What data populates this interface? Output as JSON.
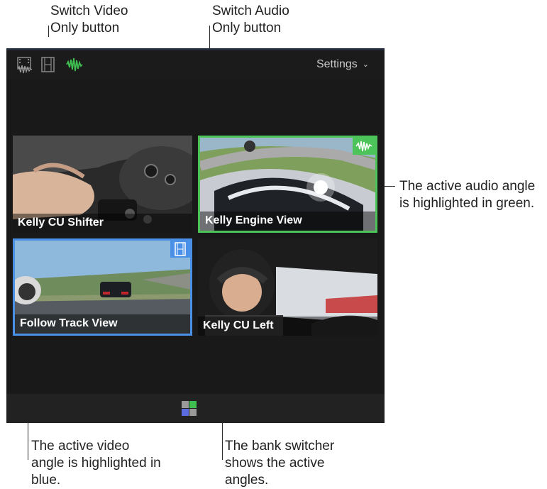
{
  "callouts": {
    "video_only": [
      "Switch Video",
      "Only button"
    ],
    "audio_only": [
      "Switch Audio",
      "Only button"
    ],
    "audio_angle": [
      "The active audio angle",
      "is highlighted in green."
    ],
    "video_angle": [
      "The active video",
      "angle is highlighted in",
      "blue."
    ],
    "bank": [
      "The bank switcher",
      "shows the active",
      "angles."
    ]
  },
  "toolbar": {
    "settings_label": "Settings",
    "settings_chevron": "⌄",
    "buttons": [
      "switch-video-and-audio-icon",
      "switch-video-only-icon",
      "switch-audio-only-icon"
    ]
  },
  "angles": [
    {
      "label": "Kelly CU Shifter",
      "state": "inactive"
    },
    {
      "label": "Kelly Engine View",
      "state": "active-audio"
    },
    {
      "label": "Follow Track View",
      "state": "active-video"
    },
    {
      "label": "Kelly CU Left",
      "state": "inactive"
    }
  ],
  "colors": {
    "audio_active": "#4cc459",
    "video_active": "#4a90e6",
    "bank_active_video": "#5b6be0",
    "bank_active_audio": "#3fbf4f",
    "bank_inactive": "#9a9a9a"
  }
}
